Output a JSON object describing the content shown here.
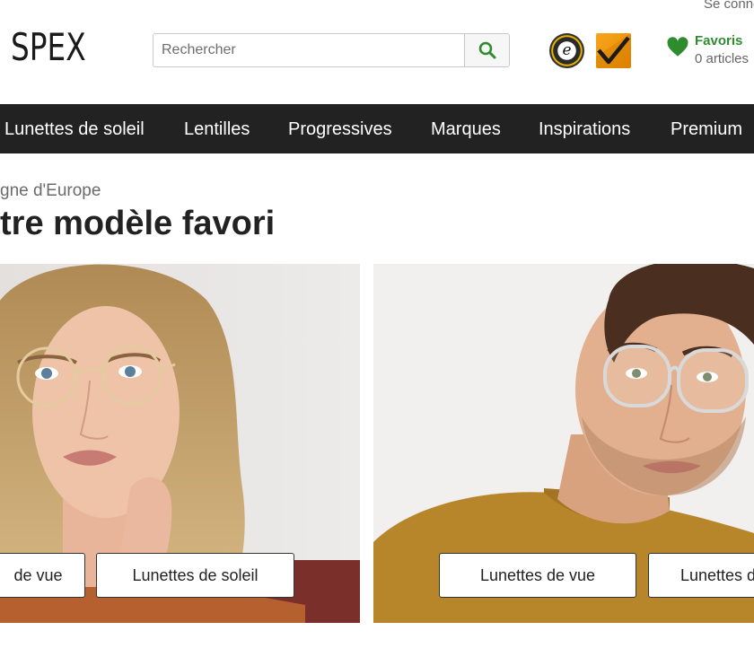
{
  "header": {
    "login_label": "Se connecter",
    "logo_text": "SPEX",
    "search": {
      "placeholder": "Rechercher",
      "value": ""
    },
    "trust_badge_letter": "e",
    "favorites": {
      "label": "Favoris",
      "count": "0 articles",
      "color": "#2e8b2e"
    }
  },
  "nav": {
    "items": [
      "Lunettes de soleil",
      "Lentilles",
      "Progressives",
      "Marques",
      "Inspirations",
      "Premium"
    ],
    "background": "#222222"
  },
  "hero": {
    "eyebrow": "gne d'Europe",
    "title": "tre modèle favori"
  },
  "cards": [
    {
      "buttons": [
        "de vue",
        "Lunettes de soleil"
      ]
    },
    {
      "buttons": [
        "Lunettes de vue",
        "Lunettes d"
      ]
    }
  ],
  "colors": {
    "accent": "#2e8b2e",
    "nav": "#222222",
    "badge_orange": "#f39c12"
  }
}
